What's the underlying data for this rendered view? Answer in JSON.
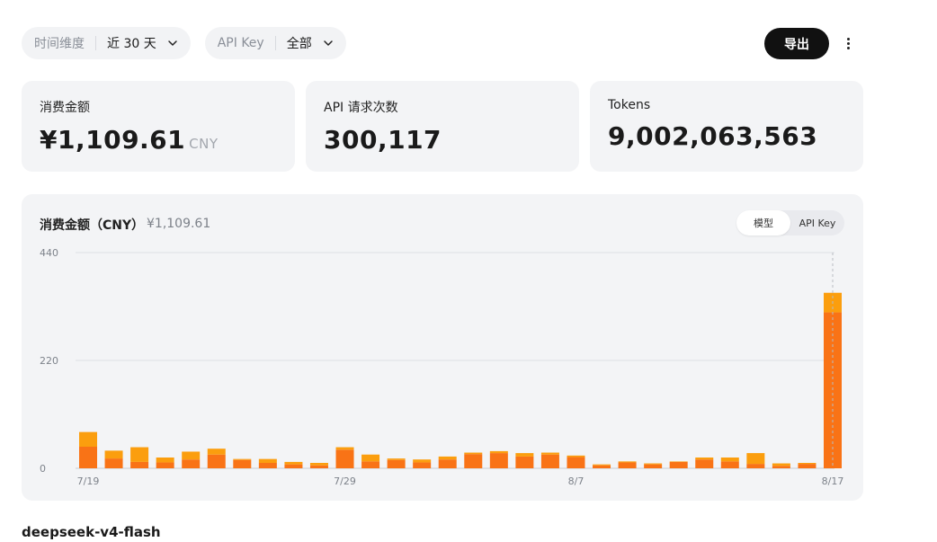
{
  "filters": {
    "time": {
      "label": "时间维度",
      "value": "近 30 天"
    },
    "apikey": {
      "label": "API Key",
      "value": "全部"
    }
  },
  "toolbar": {
    "export_label": "导出",
    "more_icon": "more-vertical-icon"
  },
  "stats": [
    {
      "title": "消费金额",
      "value": "¥1,109.61",
      "unit": "CNY"
    },
    {
      "title": "API 请求次数",
      "value": "300,117",
      "unit": ""
    },
    {
      "title": "Tokens",
      "value": "9,002,063,563",
      "unit": ""
    }
  ],
  "chart_section": {
    "title": "消费金额（CNY）",
    "total": "¥1,109.61",
    "tabs": [
      "模型",
      "API Key"
    ],
    "active_tab": "模型"
  },
  "chart_data": {
    "type": "bar",
    "stacked": true,
    "ylim": [
      0,
      440
    ],
    "yticks": [
      0,
      220,
      440
    ],
    "categories": [
      "7/19",
      "7/20",
      "7/21",
      "7/22",
      "7/23",
      "7/24",
      "7/25",
      "7/26",
      "7/27",
      "7/28",
      "7/29",
      "7/30",
      "7/31",
      "8/1",
      "8/2",
      "8/3",
      "8/4",
      "8/5",
      "8/6",
      "8/7",
      "8/8",
      "8/9",
      "8/10",
      "8/11",
      "8/12",
      "8/13",
      "8/14",
      "8/15",
      "8/16",
      "8/17"
    ],
    "xtick_labels": [
      "7/19",
      "7/29",
      "8/7",
      "8/17"
    ],
    "series": [
      {
        "color": "#f97316",
        "values": [
          44,
          20,
          13,
          12,
          18,
          28,
          17,
          11,
          8,
          6,
          38,
          14,
          17,
          12,
          18,
          29,
          31,
          24,
          28,
          23,
          6,
          12,
          8,
          13,
          18,
          14,
          9,
          5,
          9,
          318
        ]
      },
      {
        "color": "#fb9e0e",
        "values": [
          30,
          16,
          30,
          10,
          16,
          12,
          2,
          8,
          5,
          5,
          5,
          14,
          3,
          6,
          6,
          3,
          4,
          7,
          4,
          3,
          2,
          2,
          2,
          1,
          4,
          8,
          22,
          5,
          2,
          40
        ]
      }
    ],
    "grid": true
  },
  "section": {
    "model_name": "deepseek-v4-flash"
  }
}
